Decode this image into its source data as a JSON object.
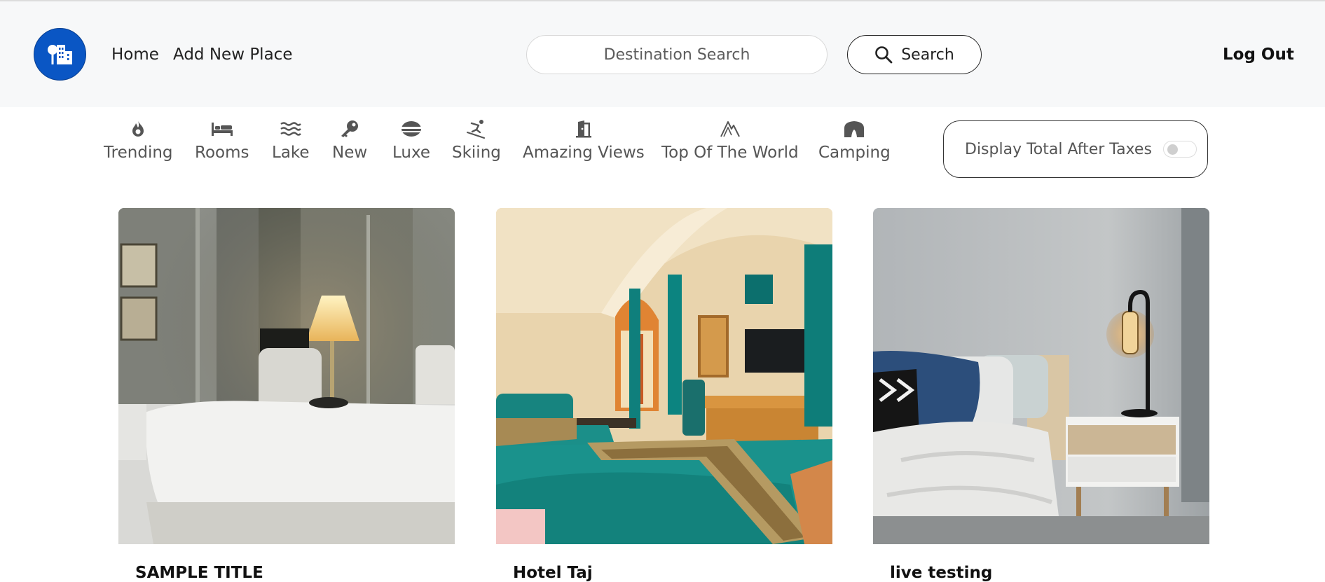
{
  "navbar": {
    "logo_icon": "city-icon",
    "links": [
      "Home",
      "Add New Place"
    ],
    "search": {
      "placeholder": "Destination Search",
      "value": "",
      "button_label": "Search"
    },
    "logout_label": "Log Out"
  },
  "filters": [
    {
      "label": "Trending",
      "icon": "fire-icon"
    },
    {
      "label": "Rooms",
      "icon": "bed-icon"
    },
    {
      "label": "Lake",
      "icon": "water-icon"
    },
    {
      "label": "New",
      "icon": "key-icon"
    },
    {
      "label": "Luxe",
      "icon": "bowl-icon"
    },
    {
      "label": "Skiing",
      "icon": "skiing-icon"
    },
    {
      "label": "Amazing Views",
      "icon": "door-icon"
    },
    {
      "label": "Top Of The World",
      "icon": "mountain-icon"
    },
    {
      "label": "Camping",
      "icon": "tent-icon"
    }
  ],
  "tax_toggle": {
    "label": "Display Total After Taxes",
    "on": false
  },
  "listings": [
    {
      "title": "SAMPLE TITLE"
    },
    {
      "title": "Hotel Taj"
    },
    {
      "title": "live testing"
    }
  ],
  "colors": {
    "brand": "#0a56c4",
    "navbar_bg": "#f7f8f9",
    "teal": "#0e8a86"
  }
}
